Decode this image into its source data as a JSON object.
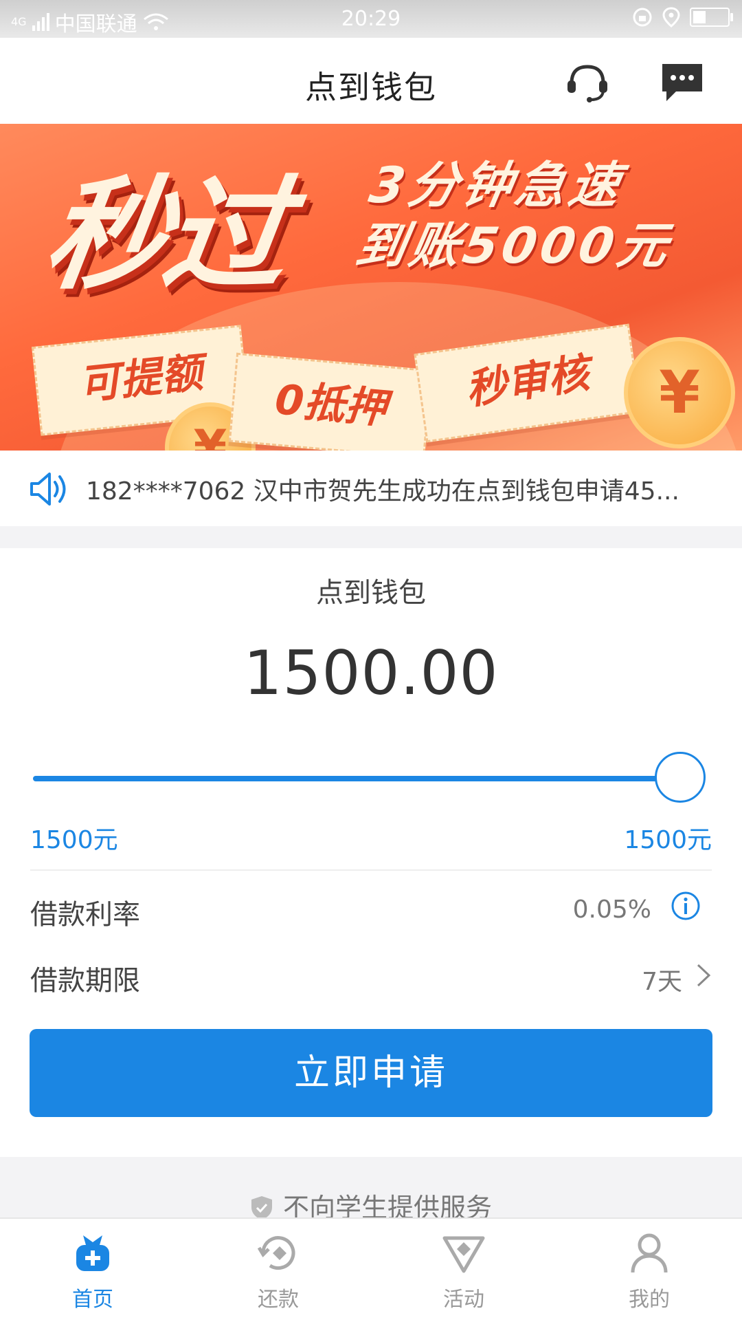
{
  "status_bar": {
    "network": "4G",
    "carrier": "中国联通",
    "time": "20:29"
  },
  "header": {
    "title": "点到钱包",
    "support_icon": "headset-icon",
    "message_icon": "chat-bubble-icon"
  },
  "banner": {
    "headline": "秒过",
    "line1": "3分钟急速",
    "line2": "到账5000元",
    "tag1": "可提额",
    "tag2": "0抵押",
    "tag3": "秒审核",
    "coin_symbol": "¥"
  },
  "marquee": {
    "icon": "speaker-icon",
    "text": "182****7062 汉中市贺先生成功在点到钱包申请45..."
  },
  "loan": {
    "title": "点到钱包",
    "amount": "1500.00",
    "slider_fraction": 1.0,
    "min_label": "1500元",
    "max_label": "1500元",
    "rate_label": "借款利率",
    "rate_value": "0.05%",
    "term_label": "借款期限",
    "term_value": "7天",
    "apply_button": "立即申请"
  },
  "notice": "不向学生提供服务",
  "nav": {
    "items": [
      {
        "label": "首页",
        "icon": "home-bag-icon",
        "active": true
      },
      {
        "label": "还款",
        "icon": "repay-icon",
        "active": false
      },
      {
        "label": "活动",
        "icon": "activity-icon",
        "active": false
      },
      {
        "label": "我的",
        "icon": "profile-icon",
        "active": false
      }
    ]
  },
  "colors": {
    "accent": "#1b86e3",
    "banner": "#ff6a3d"
  }
}
